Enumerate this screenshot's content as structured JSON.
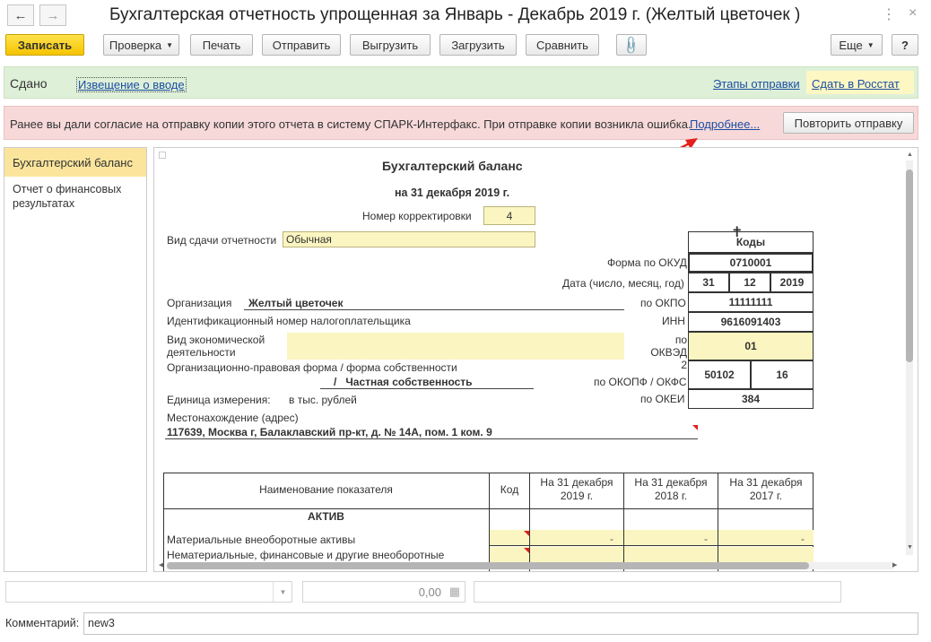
{
  "window": {
    "title": "Бухгалтерская отчетность упрощенная за Январь - Декабрь 2019 г. (Желтый цветочек  )"
  },
  "toolbar": {
    "save": "Записать",
    "check": "Проверка",
    "print": "Печать",
    "send": "Отправить",
    "export": "Выгрузить",
    "import": "Загрузить",
    "compare": "Сравнить",
    "more": "Еще",
    "help": "?"
  },
  "status": {
    "state": "Сдано",
    "notice_link": "Извещение о вводе",
    "stages_link": "Этапы отправки",
    "rosstat_link": "Сдать в Росстат"
  },
  "error": {
    "text": "Ранее вы дали согласие на отправку копии этого отчета в систему СПАРК-Интерфакс. При отправке копии возникла ошибка.",
    "details_link": "Подробнее...",
    "retry_button": "Повторить отправку"
  },
  "sidebar": {
    "items": [
      {
        "label": "Бухгалтерский баланс"
      },
      {
        "label": "Отчет о финансовых результатах"
      }
    ]
  },
  "form": {
    "title": "Бухгалтерский баланс",
    "date": "на 31 декабря 2019 г.",
    "correction_label": "Номер корректировки",
    "correction_value": "4",
    "submission_label": "Вид сдачи отчетности",
    "submission_value": "Обычная",
    "codes_header": "Коды",
    "okud_label": "Форма по ОКУД",
    "okud_value": "0710001",
    "date_label": "Дата (число, месяц, год)",
    "date_day": "31",
    "date_month": "12",
    "date_year": "2019",
    "org_label": "Организация",
    "org_value": "Желтый цветочек",
    "okpo_label": "по ОКПО",
    "okpo_value": "11111111",
    "inn_label": "Идентификационный номер налогоплательщика",
    "inn_code_label": "ИНН",
    "inn_value": "9616091403",
    "activity_label": "Вид экономической деятельности",
    "okved_label": "по ОКВЭД 2",
    "okved_value": "01",
    "legal_form_label": "Организационно-правовая форма / форма собственности",
    "legal_form_value": "/   Частная собственность",
    "okopf_label": "по ОКОПФ / ОКФС",
    "okopf_value": "50102",
    "okfs_value": "16",
    "unit_label": "Единица измерения:",
    "unit_value": "в тыс. рублей",
    "okei_label": "по ОКЕИ",
    "okei_value": "384",
    "address_label": "Местонахождение (адрес)",
    "address_value": "117639, Москва г, Балаклавский пр-кт, д. № 14А, пом. 1 ком. 9"
  },
  "table": {
    "col_name": "Наименование показателя",
    "col_code": "Код",
    "col_2019": "На 31 декабря 2019 г.",
    "col_2018": "На 31 декабря 2018 г.",
    "col_2017": "На 31 декабря 2017 г.",
    "section": "АКТИВ",
    "row1": "Материальные внеоборотные активы",
    "row2": "Нематериальные, финансовые и другие внеоборотные",
    "dash": "-"
  },
  "bottom": {
    "amount": "0,00",
    "comment_label": "Комментарий:",
    "comment_value": "new3"
  }
}
